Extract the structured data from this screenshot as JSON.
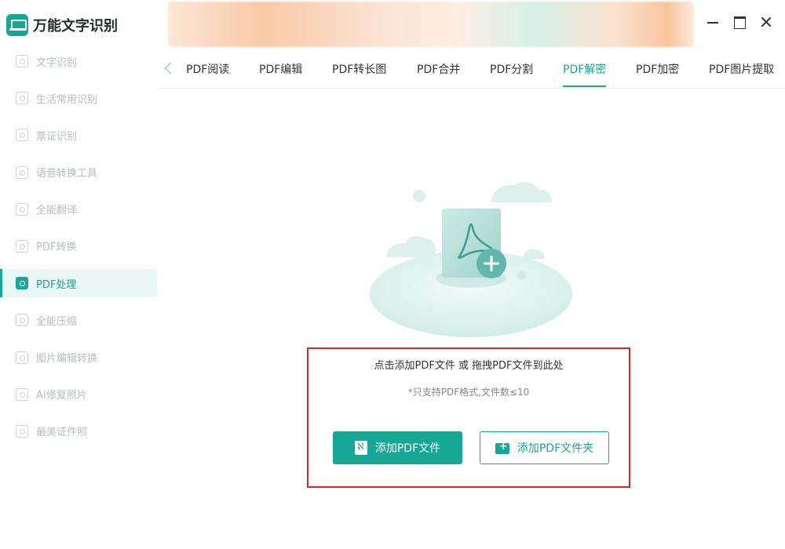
{
  "app": {
    "title": "万能文字识别"
  },
  "sidebar": {
    "items": [
      {
        "label": "文字识别",
        "icon": "scan-icon"
      },
      {
        "label": "生活常用识别",
        "icon": "scan-icon"
      },
      {
        "label": "票证识别",
        "icon": "scan-icon"
      },
      {
        "label": "语音转换工具",
        "icon": "audio-icon"
      },
      {
        "label": "全能翻译",
        "icon": "translate-icon"
      },
      {
        "label": "PDF转换",
        "icon": "pdf-icon"
      },
      {
        "label": "PDF处理",
        "icon": "pdf-icon",
        "active": true
      },
      {
        "label": "全能压缩",
        "icon": "compress-icon"
      },
      {
        "label": "图片编辑转换",
        "icon": "image-icon"
      },
      {
        "label": "AI修复照片",
        "icon": "photo-icon"
      },
      {
        "label": "最美证件照",
        "icon": "id-photo-icon"
      }
    ]
  },
  "tabs": [
    {
      "label": "PDF阅读"
    },
    {
      "label": "PDF编辑"
    },
    {
      "label": "PDF转长图"
    },
    {
      "label": "PDF合并"
    },
    {
      "label": "PDF分割"
    },
    {
      "label": "PDF解密",
      "active": true
    },
    {
      "label": "PDF加密"
    },
    {
      "label": "PDF图片提取"
    }
  ],
  "dropzone": {
    "title": "点击添加PDF文件 或 拖拽PDF文件到此处",
    "subtitle": "*只支持PDF格式,文件数≤10",
    "add_file_label": "添加PDF文件",
    "add_folder_label": "添加PDF文件夹"
  },
  "colors": {
    "accent": "#17a895",
    "highlight_border": "#e02424"
  }
}
